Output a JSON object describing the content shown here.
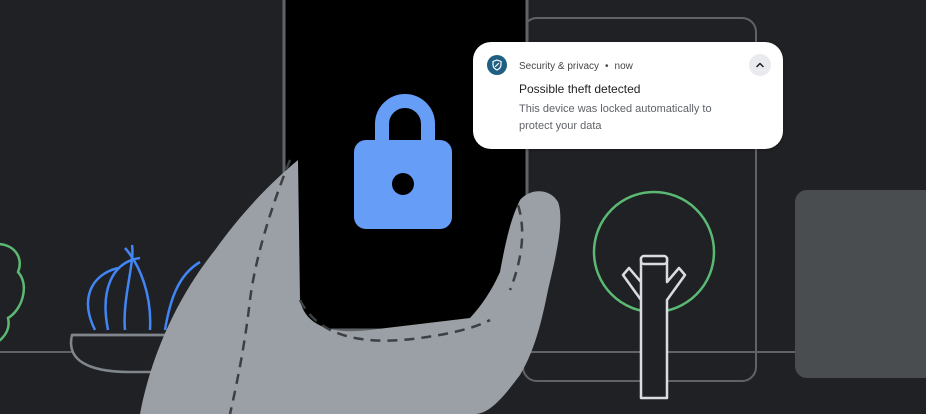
{
  "notification": {
    "app_name": "Security & privacy",
    "separator": "•",
    "time": "now",
    "title": "Possible theft detected",
    "body": "This device was locked automatically to protect your data",
    "app_icon": "shield-icon",
    "expand_icon": "chevron-up-icon"
  },
  "colors": {
    "background": "#202124",
    "phone_screen": "#000000",
    "lock_icon": "#669df6",
    "hand": "#9aa0a6",
    "plant_green": "#5bb974",
    "water_blue": "#4285f4",
    "notification_bg": "#ffffff"
  },
  "icons": {
    "phone_lock": "lock-icon",
    "tree": "tree-icon",
    "fountain": "fountain-icon",
    "bush": "bush-icon"
  }
}
